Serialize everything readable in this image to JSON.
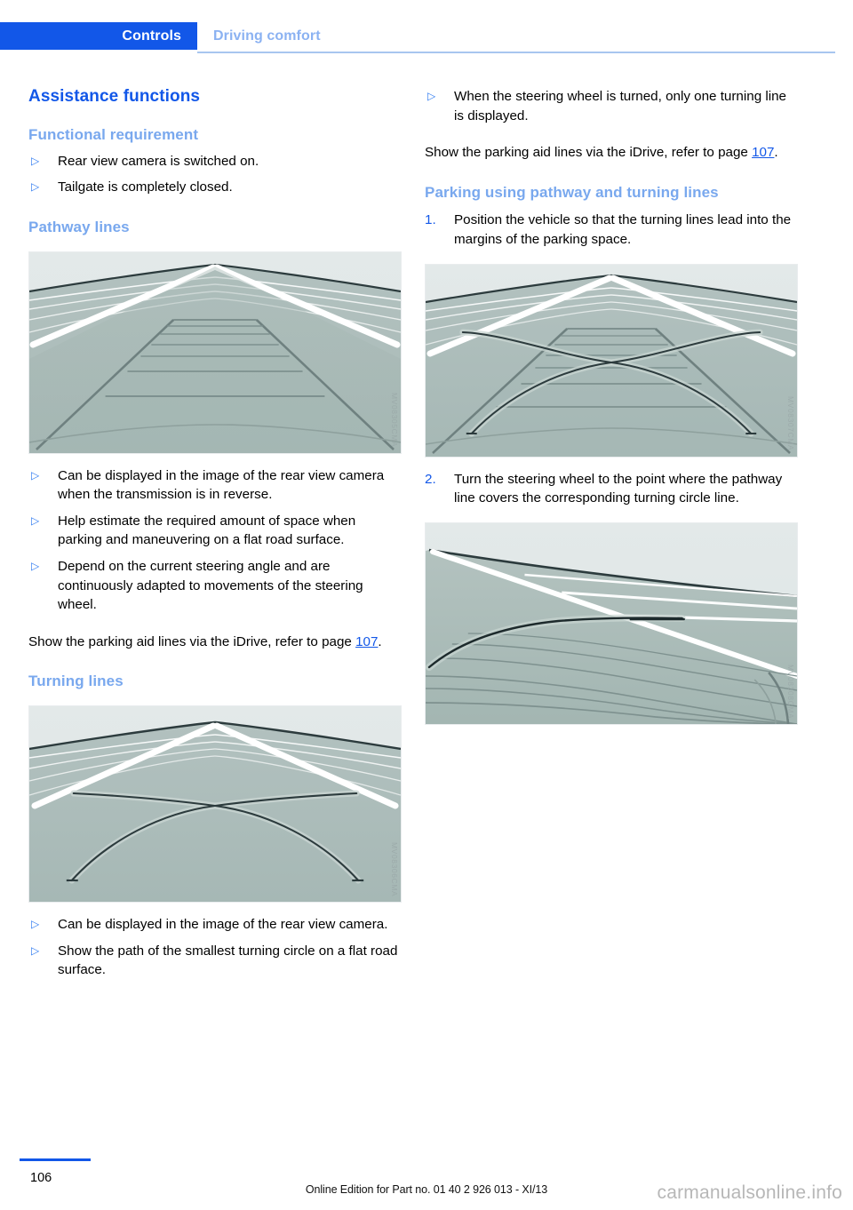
{
  "header": {
    "active_tab": "Controls",
    "inactive_tab": "Driving comfort",
    "active_color": "#1257e8",
    "inactive_color": "#8bb2f2"
  },
  "left_column": {
    "title": "Assistance functions",
    "section_functional": {
      "heading": "Functional requirement",
      "bullets": [
        "Rear view camera is switched on.",
        "Tailgate is completely closed."
      ]
    },
    "section_pathway": {
      "heading": "Pathway lines",
      "figure_watermark": "MV08305CMA",
      "bullets": [
        "Can be displayed in the image of the rear view camera when the transmission is in reverse.",
        "Help estimate the required amount of space when parking and maneuvering on a flat road surface.",
        "Depend on the current steering angle and are continuously adapted to movements of the steering wheel."
      ],
      "note_before": "Show the parking aid lines via the iDrive, refer to page ",
      "note_link": "107",
      "note_after": "."
    },
    "section_turning": {
      "heading": "Turning lines",
      "figure_watermark": "MV08306CMA",
      "bullets": [
        "Can be displayed in the image of the rear view camera.",
        "Show the path of the smallest turning circle on a flat road surface."
      ]
    }
  },
  "right_column": {
    "top_bullets": [
      "When the steering wheel is turned, only one turning line is displayed."
    ],
    "note_before": "Show the parking aid lines via the iDrive, refer to page ",
    "note_link": "107",
    "note_after": ".",
    "section_parking": {
      "heading": "Parking using pathway and turning lines",
      "steps": [
        {
          "number": "1.",
          "text": "Position the vehicle so that the turning lines lead into the margins of the parking space.",
          "figure_watermark": "MV08307CMA"
        },
        {
          "number": "2.",
          "text": "Turn the steering wheel to the point where the pathway line covers the corresponding turning circle line.",
          "figure_watermark": "MV08308CMA"
        }
      ]
    }
  },
  "footer": {
    "page_number": "106",
    "edition_text": "Online Edition for Part no. 01 40 2 926 013 - XI/13",
    "site_watermark": "carmanualsonline.info"
  }
}
